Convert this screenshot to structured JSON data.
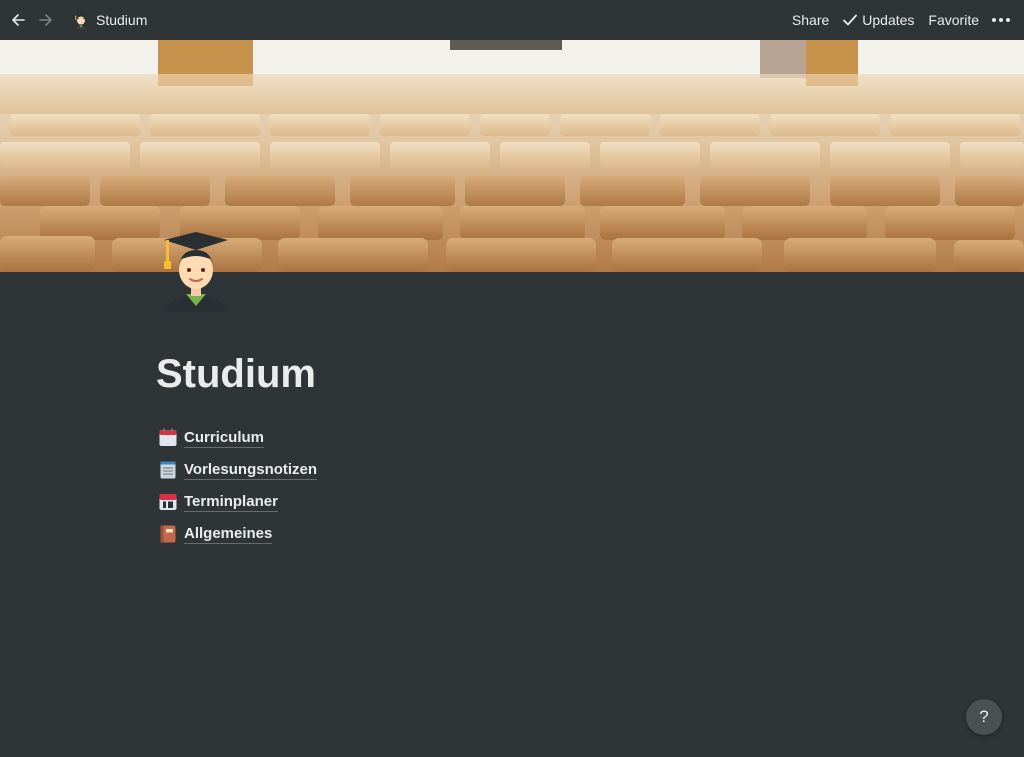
{
  "topbar": {
    "back_icon": "arrow-left-icon",
    "forward_icon": "arrow-right-icon",
    "breadcrumb_title": "Studium",
    "share": "Share",
    "updates": "Updates",
    "favorite": "Favorite",
    "more_icon": "ellipsis-icon"
  },
  "page": {
    "icon": "student-graduation-cap-icon",
    "title": "Studium",
    "links": [
      {
        "icon": "calendar-icon",
        "label": "Curriculum"
      },
      {
        "icon": "notepad-icon",
        "label": "Vorlesungsnotizen"
      },
      {
        "icon": "date-calendar-icon",
        "label": "Terminplaner"
      },
      {
        "icon": "notebook-icon",
        "label": "Allgemeines"
      }
    ]
  },
  "help": {
    "label": "?"
  },
  "colors": {
    "background": "#2f3437",
    "text": "#ebebeb",
    "help_button": "#4b5053"
  }
}
